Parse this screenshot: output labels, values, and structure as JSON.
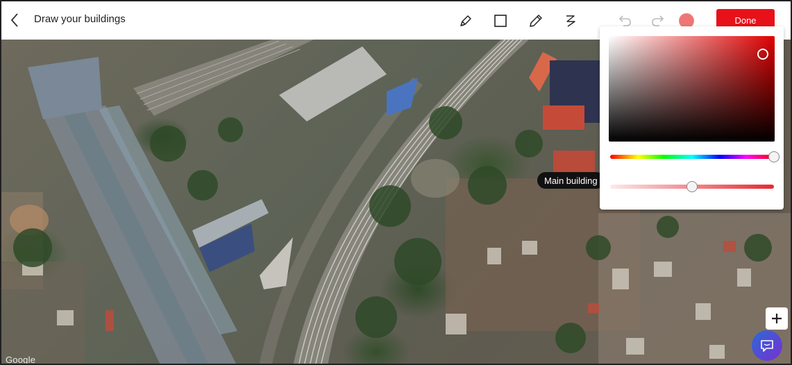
{
  "header": {
    "title": "Draw your buildings",
    "done_label": "Done"
  },
  "toolbar": {
    "tools": [
      {
        "name": "pen-tool-icon"
      },
      {
        "name": "rectangle-tool-icon"
      },
      {
        "name": "pencil-tool-icon"
      },
      {
        "name": "freehand-tool-icon"
      },
      {
        "name": "undo-icon"
      },
      {
        "name": "redo-icon"
      }
    ],
    "current_color": "#f07575"
  },
  "color_picker": {
    "hue_color": "#e00000",
    "hue_level": 1.0,
    "opacity_level": 0.5
  },
  "map": {
    "label": "Main building",
    "attribution": "Google"
  },
  "colors": {
    "accent": "#e8111a",
    "text": "#1f1f1f"
  }
}
